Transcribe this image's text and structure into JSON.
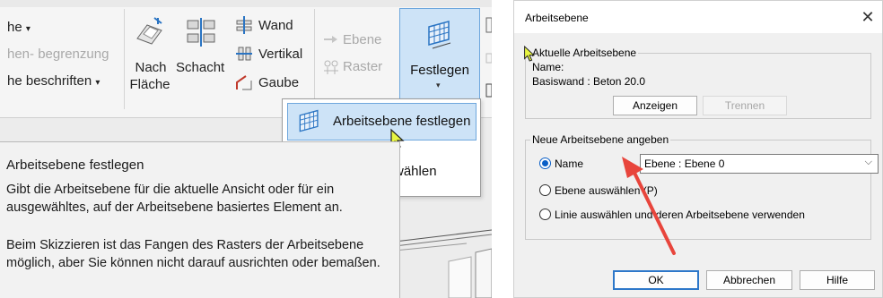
{
  "ribbon": {
    "top_fragment": "~",
    "col1": {
      "row1": "he",
      "row2": "hen- begrenzung",
      "row3": "he beschriften"
    },
    "nach_flaeche_line1": "Nach",
    "nach_flaeche_line2": "Fläche",
    "schacht_label": "Schacht",
    "wand_label": "Wand",
    "vertikal_label": "Vertikal",
    "gaube_label": "Gaube",
    "ebene_label": "Ebene",
    "raster_label": "Raster",
    "festlegen_label": "Festlegen",
    "dropdown_caret": "▾"
  },
  "dropdown": {
    "item1": "Arbeitsebene festlegen",
    "item2_partial": "wählen"
  },
  "tooltip": {
    "title": "Arbeitsebene festlegen",
    "para1": "Gibt die Arbeitsebene für die aktuelle Ansicht oder für ein ausgewähltes, auf der Arbeitsebene basiertes Element an.",
    "para2": "Beim Skizzieren ist das Fangen des Rasters der Arbeitsebene möglich, aber Sie können nicht darauf ausrichten oder bemaßen."
  },
  "dialog": {
    "title": "Arbeitsebene",
    "close": "✕",
    "current_group": "Aktuelle Arbeitsebene",
    "name_label": "Name:",
    "name_value": "Basiswand : Beton 20.0",
    "btn_show": "Anzeigen",
    "btn_separate": "Trennen",
    "new_group": "Neue Arbeitsebene angeben",
    "opt_name": "Name",
    "select_value": "Ebene : Ebene 0",
    "select_chevron": "⌵",
    "opt_pick_plane": "Ebene auswählen (P)",
    "opt_pick_line": "Linie auswählen und deren Arbeitsebene verwenden",
    "btn_ok": "OK",
    "btn_cancel": "Abbrechen",
    "btn_help": "Hilfe"
  },
  "colors": {
    "highlight": "#cde3f7",
    "highlight_border": "#6ea7dd",
    "arrow": "#e8453c",
    "cursor_yellow": "#e8f542"
  }
}
